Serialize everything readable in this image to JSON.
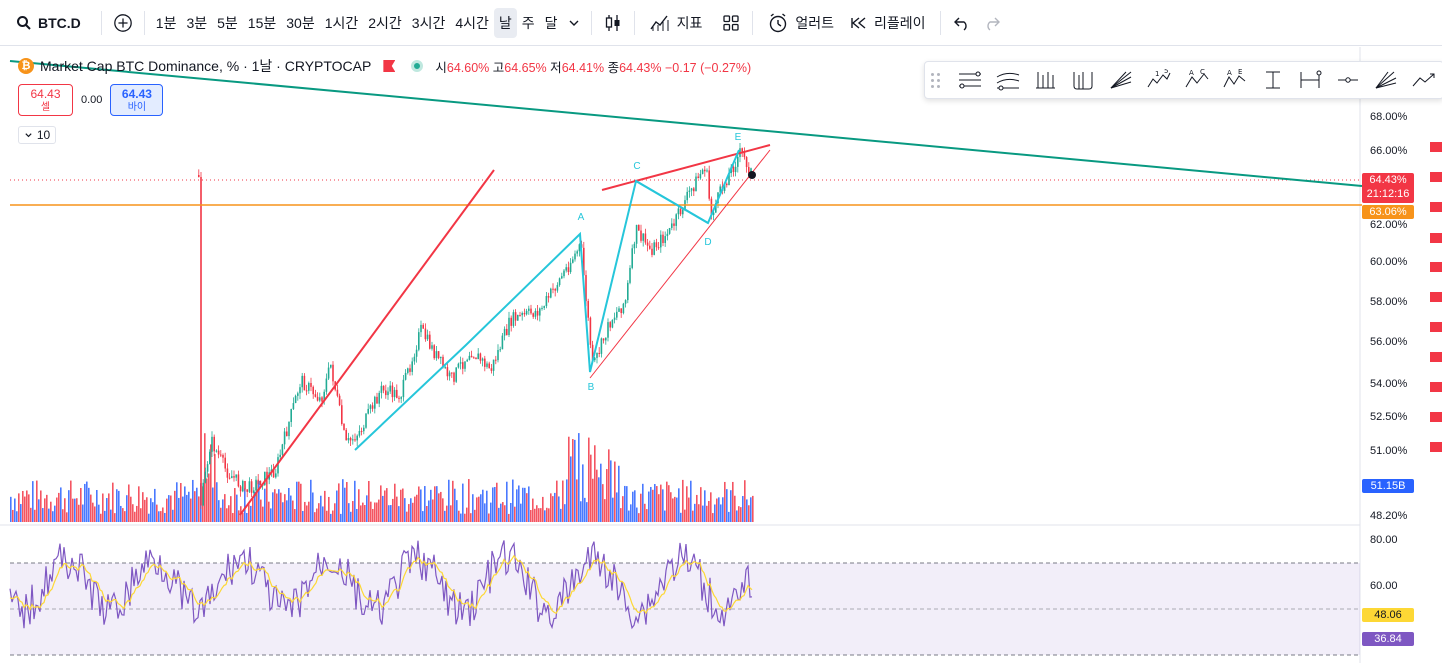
{
  "toolbar": {
    "symbol": "BTC.D",
    "intervals": [
      "1분",
      "3분",
      "5분",
      "15분",
      "30분",
      "1시간",
      "2시간",
      "3시간",
      "4시간",
      "날",
      "주",
      "달"
    ],
    "active_interval": "날",
    "indicators_label": "지표",
    "alert_label": "얼러트",
    "replay_label": "리플레이"
  },
  "legend": {
    "title": "Market Cap BTC Dominance, % · 1날 · CRYPTOCAP",
    "open_label": "시",
    "open": "64.60%",
    "high_label": "고",
    "high": "64.65%",
    "low_label": "저",
    "low": "64.41%",
    "close_label": "종",
    "close": "64.43%",
    "change": "−0.17 (−0.27%)"
  },
  "trade": {
    "sell_price": "64.43",
    "sell_label": "셀",
    "spread": "0.00",
    "buy_price": "64.43",
    "buy_label": "바이"
  },
  "collapse_count": "10",
  "price_axis": [
    "68.00%",
    "66.00%",
    "62.00%",
    "60.00%",
    "58.00%",
    "56.00%",
    "54.00%",
    "52.50%",
    "51.00%",
    "48.20%"
  ],
  "price_tag": {
    "value": "64.43%",
    "countdown": "21:12:16"
  },
  "hline_tag": "63.06%",
  "volume_tag": "51.15B",
  "rsi_axis": [
    "80.00",
    "60.00"
  ],
  "rsi_tag": "48.06",
  "rsi_ma_tag": "36.84",
  "pattern_labels": [
    "A",
    "B",
    "C",
    "D",
    "E"
  ],
  "colors": {
    "up": "#22ab94",
    "down": "#f23645",
    "trendline": "#089981",
    "orange": "#f7931a",
    "channel": "#f23645",
    "pattern": "#26c6da",
    "volume_up": "#2962ff",
    "volume_down": "#f23645",
    "rsi": "#7e57c2",
    "rsi_ma": "#fdd835"
  },
  "icons": [
    "search-icon",
    "add-icon",
    "chevron-down-icon",
    "candles-icon",
    "indicators-icon",
    "layout-icon",
    "alert-icon",
    "replay-icon",
    "undo-icon",
    "redo-icon"
  ]
}
